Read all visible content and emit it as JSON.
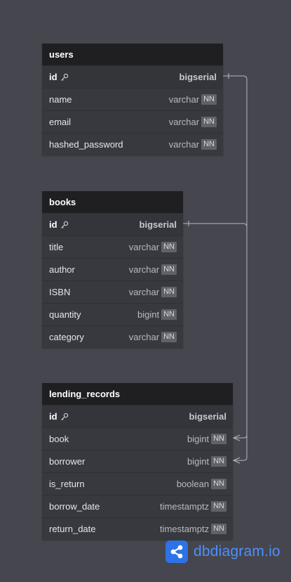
{
  "colors": {
    "canvas": "#46464f",
    "table_header": "#1f1f22",
    "table_body": "#38383f",
    "connector": "#b8b8c0",
    "brand": "#2d72e6"
  },
  "tables": {
    "users": {
      "name": "users",
      "columns": [
        {
          "name": "id",
          "type": "bigserial",
          "pk": true,
          "nn": ""
        },
        {
          "name": "name",
          "type": "varchar",
          "nn": "NN"
        },
        {
          "name": "email",
          "type": "varchar",
          "nn": "NN"
        },
        {
          "name": "hashed_password",
          "type": "varchar",
          "nn": "NN"
        }
      ]
    },
    "books": {
      "name": "books",
      "columns": [
        {
          "name": "id",
          "type": "bigserial",
          "pk": true,
          "nn": ""
        },
        {
          "name": "title",
          "type": "varchar",
          "nn": "NN"
        },
        {
          "name": "author",
          "type": "varchar",
          "nn": "NN"
        },
        {
          "name": "ISBN",
          "type": "varchar",
          "nn": "NN"
        },
        {
          "name": "quantity",
          "type": "bigint",
          "nn": "NN"
        },
        {
          "name": "category",
          "type": "varchar",
          "nn": "NN"
        }
      ]
    },
    "lending_records": {
      "name": "lending_records",
      "columns": [
        {
          "name": "id",
          "type": "bigserial",
          "pk": true,
          "nn": ""
        },
        {
          "name": "book",
          "type": "bigint",
          "nn": "NN"
        },
        {
          "name": "borrower",
          "type": "bigint",
          "nn": "NN"
        },
        {
          "name": "is_return",
          "type": "boolean",
          "nn": "NN"
        },
        {
          "name": "borrow_date",
          "type": "timestamptz",
          "nn": "NN"
        },
        {
          "name": "return_date",
          "type": "timestamptz",
          "nn": "NN"
        }
      ]
    }
  },
  "relationships": [
    {
      "from": "lending_records.book",
      "to": "books.id",
      "cardinality": "many-to-one"
    },
    {
      "from": "lending_records.borrower",
      "to": "users.id",
      "cardinality": "many-to-one"
    }
  ],
  "icons": {
    "primary_key": "key-icon",
    "logo": "share-nodes-icon"
  },
  "brand": {
    "name": "dbdiagram",
    "suffix": ".io"
  }
}
